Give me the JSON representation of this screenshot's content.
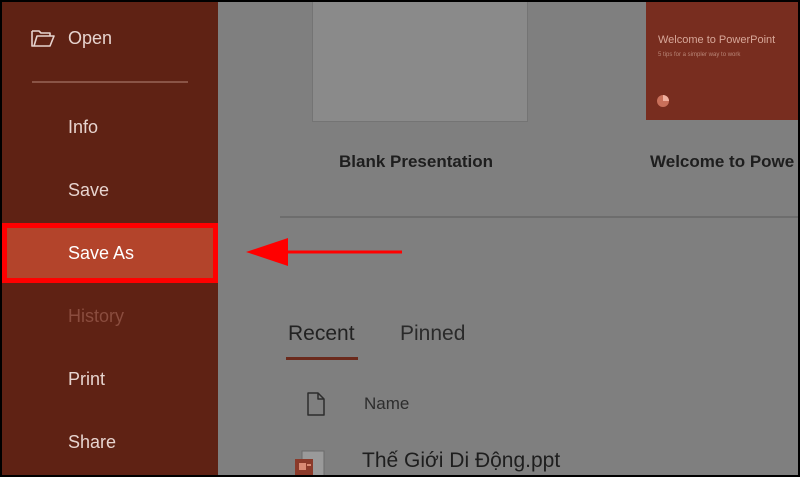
{
  "sidebar": {
    "open_label": "Open",
    "items": [
      {
        "label": "Info"
      },
      {
        "label": "Save"
      },
      {
        "label": "Save As"
      },
      {
        "label": "History"
      },
      {
        "label": "Print"
      },
      {
        "label": "Share"
      }
    ]
  },
  "templates": {
    "blank_label": "Blank Presentation",
    "welcome_label": "Welcome to Powe",
    "welcome_thumb_title": "Welcome to PowerPoint",
    "welcome_thumb_subtitle": "5 tips for a simpler way to work"
  },
  "tabs": {
    "recent": "Recent",
    "pinned": "Pinned"
  },
  "file_list": {
    "column_name": "Name",
    "rows": [
      {
        "name": "Thế Giới Di Động.ppt"
      }
    ]
  },
  "colors": {
    "sidebar_bg": "#5f2214",
    "selected_item_bg": "#b3442b",
    "highlight_border": "#ff0000",
    "annotation_arrow": "#ff0000",
    "main_bg": "#7f7f7f"
  },
  "icons": {
    "open": "folder-open-icon",
    "document": "document-icon",
    "file": "powerpoint-file-icon",
    "annotation": "arrow-left-icon"
  }
}
